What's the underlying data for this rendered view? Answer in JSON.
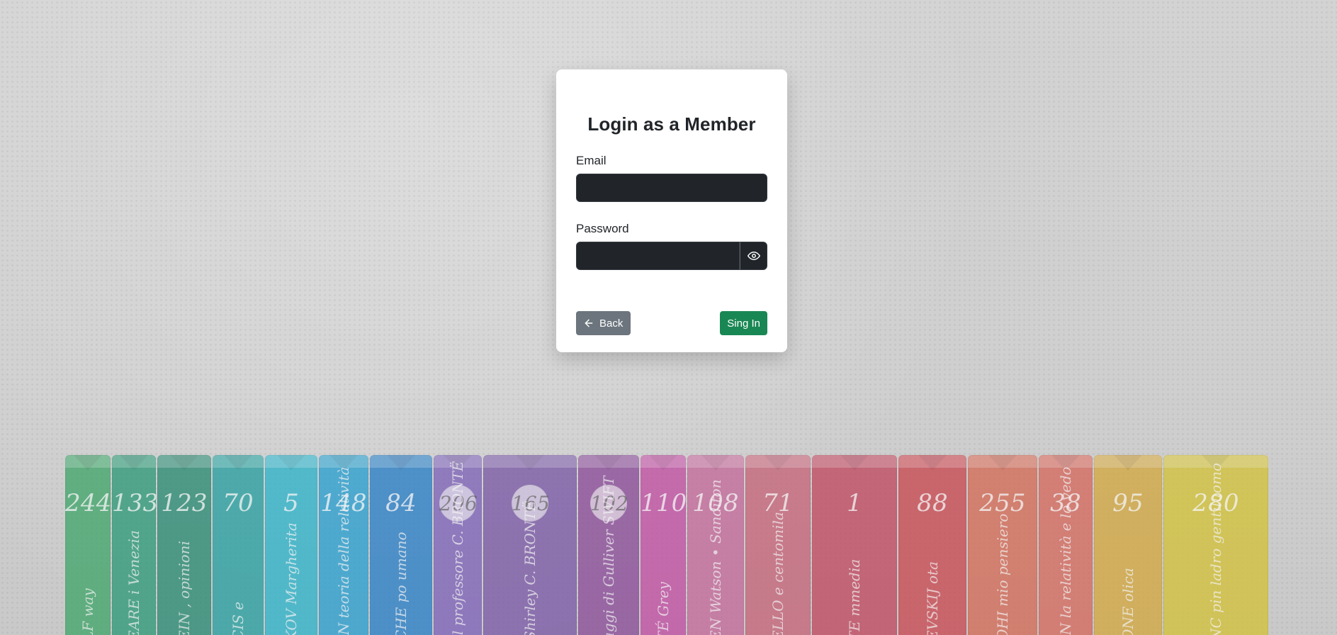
{
  "form": {
    "title": "Login as a Member",
    "email": {
      "label": "Email",
      "value": "",
      "placeholder": ""
    },
    "password": {
      "label": "Password",
      "value": "",
      "placeholder": ""
    },
    "buttons": {
      "back_label": "Back",
      "sign_in_label": "Sing In"
    },
    "icons": {
      "password_toggle": "eye-icon",
      "back": "arrow-left-icon"
    }
  },
  "background": {
    "books": [
      {
        "number": "244",
        "spine_text": "LF\nway",
        "color": "#43a66c"
      },
      {
        "number": "133",
        "spine_text": "EARE\ni Venezia",
        "color": "#2f9a78"
      },
      {
        "number": "123",
        "spine_text": "EIN\n, opinioni",
        "color": "#2b8b73"
      },
      {
        "number": "70",
        "spine_text": "CIS\ne",
        "color": "#2aa0a0"
      },
      {
        "number": "5",
        "spine_text": "KOV\nMargherita",
        "color": "#2fb3c9"
      },
      {
        "number": "148",
        "spine_text": "IN\nteoria della relatività",
        "color": "#2b9fcf"
      },
      {
        "number": "84",
        "spine_text": "CHE\npo umano",
        "color": "#2a7fc6"
      },
      {
        "number": "206",
        "spine_text": "Il professore\nC. BRONTË",
        "color": "#7e63b8"
      },
      {
        "number": "165",
        "spine_text": "Shirley\nC. BRONTË",
        "color": "#7b5aa6"
      },
      {
        "number": "102",
        "spine_text": "aggi di Gulliver\nSWIFT",
        "color": "#8b4d99"
      },
      {
        "number": "110",
        "spine_text": "TÉ\nGrey",
        "color": "#c14fa3"
      },
      {
        "number": "108",
        "spine_text": "EN\nWatson • Sanditon",
        "color": "#c46a9a"
      },
      {
        "number": "71",
        "spine_text": "ELLO\ne centomila",
        "color": "#c66579"
      },
      {
        "number": "1",
        "spine_text": "TE\nmmedia",
        "color": "#c14a61"
      },
      {
        "number": "88",
        "spine_text": "EVSKIJ\nota",
        "color": "#c94a52"
      },
      {
        "number": "255",
        "spine_text": "OHI\nmio pensiero",
        "color": "#d46b57"
      },
      {
        "number": "38",
        "spine_text": "IN\nla relatività\ne lo vedo",
        "color": "#d56a5e"
      },
      {
        "number": "95",
        "spine_text": "ONE\nolica",
        "color": "#d3a842"
      },
      {
        "number": "280",
        "spine_text": "NC\npin ladro gentiluomo",
        "color": "#d3c23a"
      }
    ]
  }
}
